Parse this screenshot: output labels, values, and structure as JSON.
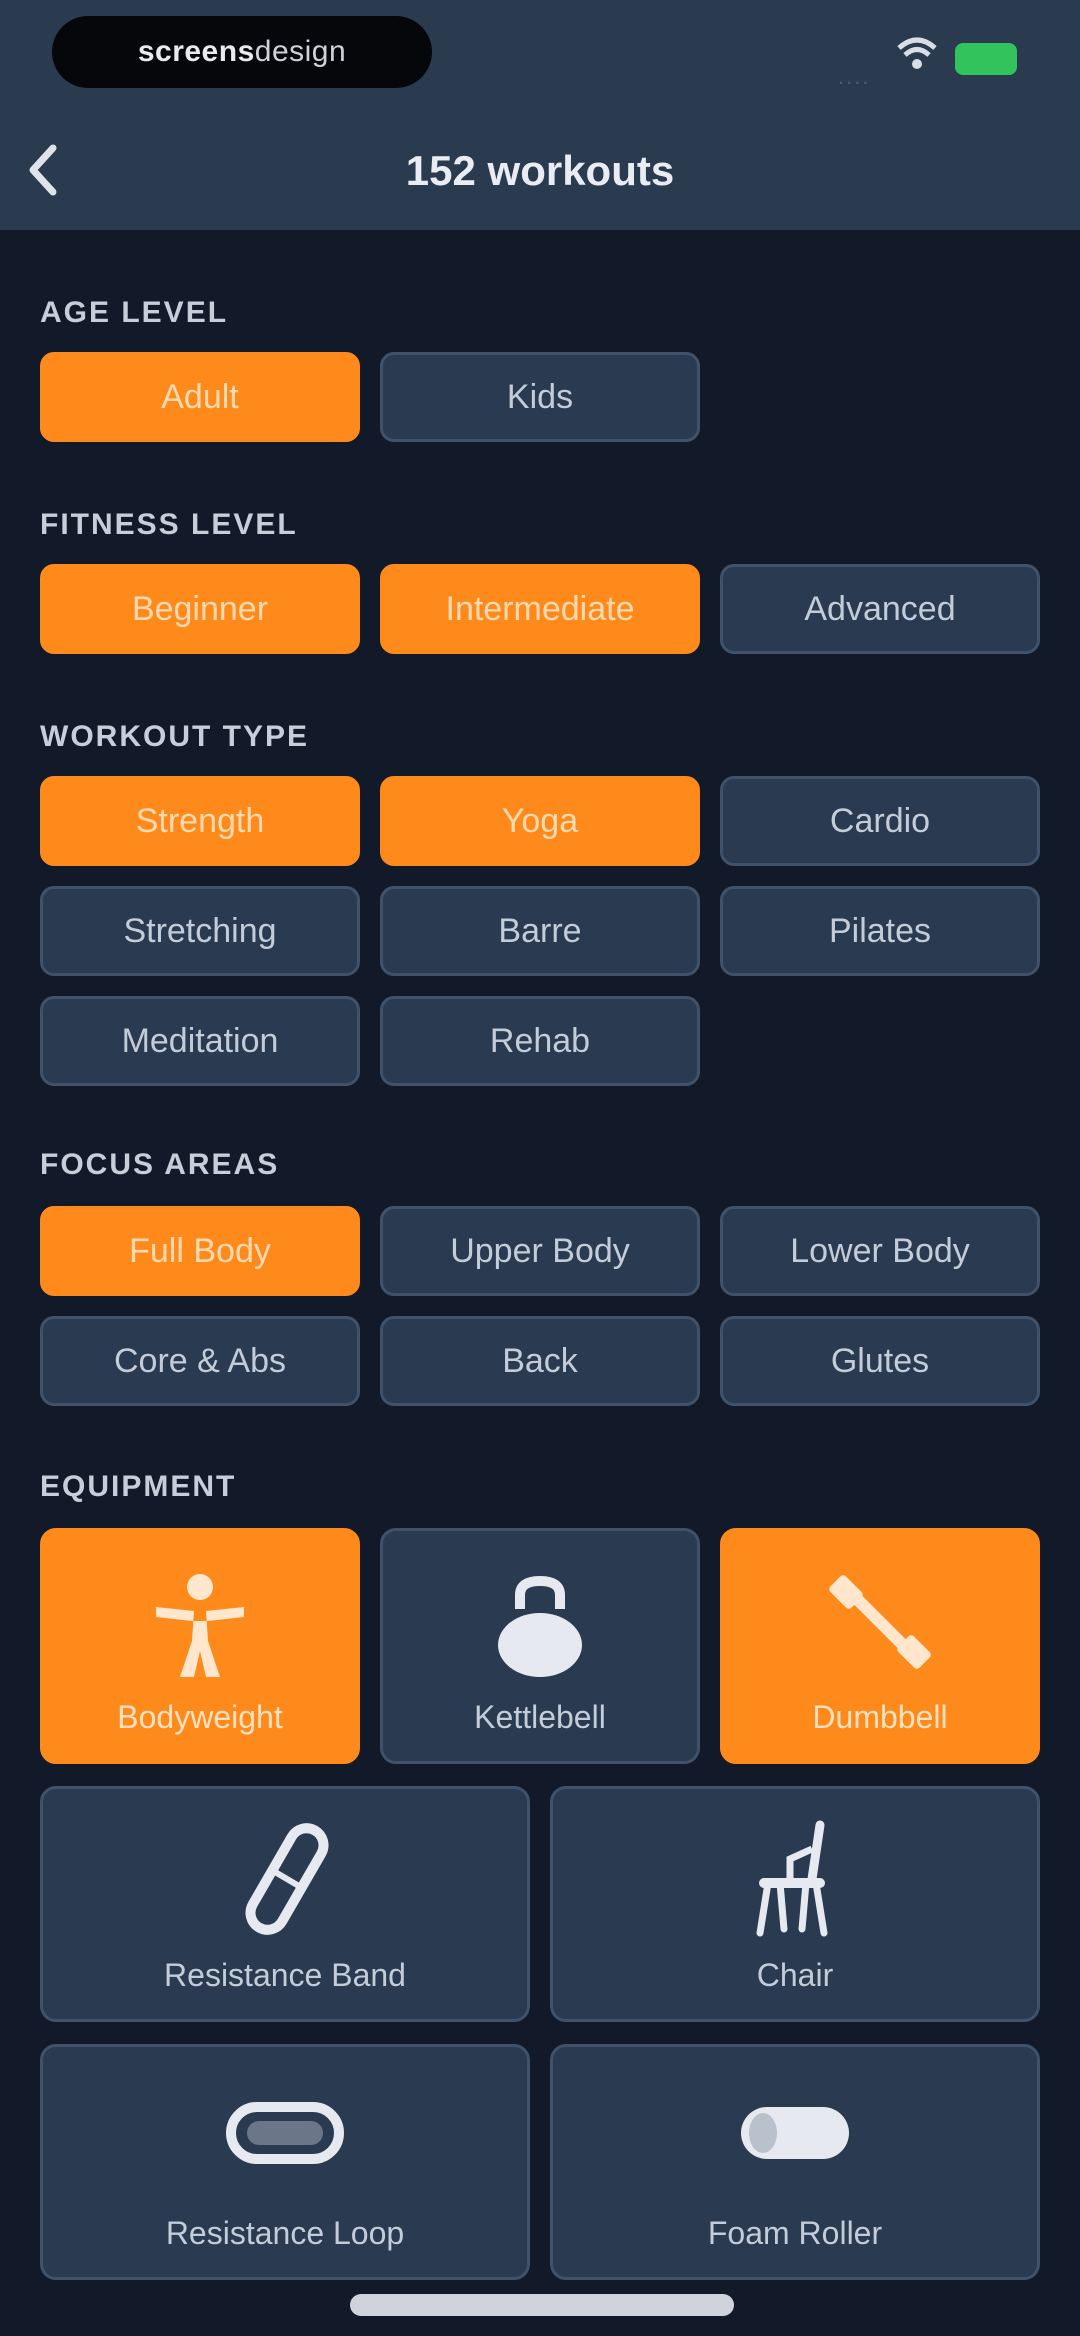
{
  "status_bar": {
    "pill_bold": "screens",
    "pill_light": "design",
    "signal": "....",
    "accent_battery": "#33c35c"
  },
  "nav": {
    "back_icon": "chevron-left-icon",
    "title": "152 workouts"
  },
  "sections": {
    "age_level": {
      "label": "AGE LEVEL",
      "options": [
        {
          "label": "Adult",
          "selected": true
        },
        {
          "label": "Kids",
          "selected": false
        }
      ]
    },
    "fitness_level": {
      "label": "FITNESS LEVEL",
      "options": [
        {
          "label": "Beginner",
          "selected": true
        },
        {
          "label": "Intermediate",
          "selected": true
        },
        {
          "label": "Advanced",
          "selected": false
        }
      ]
    },
    "workout_type": {
      "label": "WORKOUT TYPE",
      "options": [
        {
          "label": "Strength",
          "selected": true
        },
        {
          "label": "Yoga",
          "selected": true
        },
        {
          "label": "Cardio",
          "selected": false
        },
        {
          "label": "Stretching",
          "selected": false
        },
        {
          "label": "Barre",
          "selected": false
        },
        {
          "label": "Pilates",
          "selected": false
        },
        {
          "label": "Meditation",
          "selected": false
        },
        {
          "label": "Rehab",
          "selected": false
        }
      ]
    },
    "focus_areas": {
      "label": "FOCUS AREAS",
      "options": [
        {
          "label": "Full Body",
          "selected": true
        },
        {
          "label": "Upper Body",
          "selected": false
        },
        {
          "label": "Lower Body",
          "selected": false
        },
        {
          "label": "Core & Abs",
          "selected": false
        },
        {
          "label": "Back",
          "selected": false
        },
        {
          "label": "Glutes",
          "selected": false
        }
      ]
    },
    "equipment": {
      "label": "EQUIPMENT",
      "items": [
        {
          "label": "Bodyweight",
          "icon": "person-icon",
          "selected": true
        },
        {
          "label": "Kettlebell",
          "icon": "kettlebell-icon",
          "selected": false
        },
        {
          "label": "Dumbbell",
          "icon": "dumbbell-icon",
          "selected": true
        },
        {
          "label": "Resistance Band",
          "icon": "resistance-band-icon",
          "selected": false
        },
        {
          "label": "Chair",
          "icon": "chair-icon",
          "selected": false
        },
        {
          "label": "Resistance Loop",
          "icon": "resistance-loop-icon",
          "selected": false
        },
        {
          "label": "Foam Roller",
          "icon": "foam-roller-icon",
          "selected": false
        }
      ]
    }
  },
  "colors": {
    "accent": "#ff8a1c",
    "background": "#121a29",
    "chip": "#2a3a50",
    "header": "#2a3a4f"
  }
}
